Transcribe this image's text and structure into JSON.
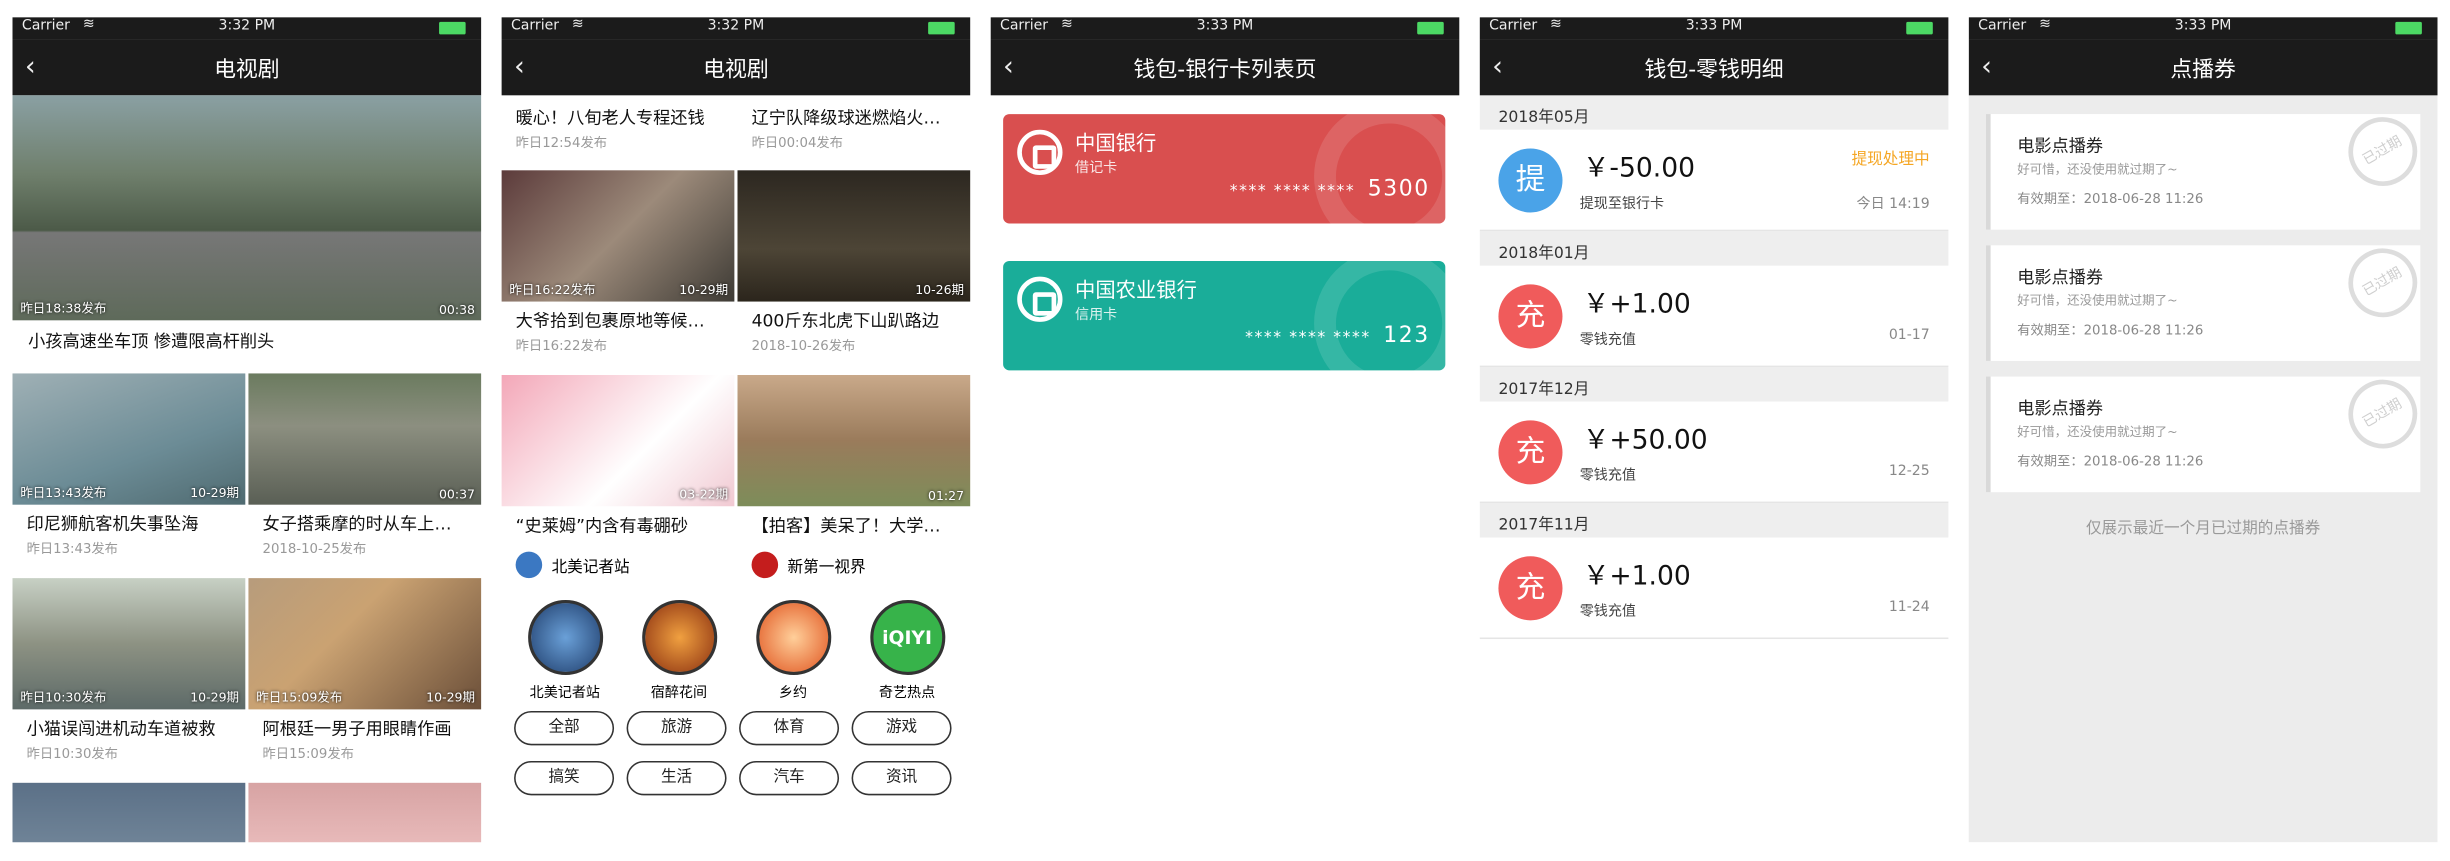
{
  "status": {
    "carrier": "Carrier",
    "screens": [
      {
        "time": "3:32 PM"
      },
      {
        "time": "3:32 PM"
      },
      {
        "time": "3:33 PM"
      },
      {
        "time": "3:33 PM"
      },
      {
        "time": "3:33 PM"
      }
    ]
  },
  "screen1": {
    "title": "电视剧",
    "hero": {
      "left": "昨日18:38发布",
      "right": "00:38",
      "caption": "小孩高速坐车顶 惨遭限高杆削头"
    },
    "rows": [
      [
        {
          "left": "昨日13:43发布",
          "right": "10-29期",
          "title": "印尼狮航客机失事坠海",
          "sub": "昨日13:43发布"
        },
        {
          "left": "",
          "right": "00:37",
          "title": "女子搭乘摩的时从车上…",
          "sub": "2018-10-25发布"
        }
      ],
      [
        {
          "left": "昨日10:30发布",
          "right": "10-29期",
          "title": "小猫误闯进机动车道被救",
          "sub": "昨日10:30发布"
        },
        {
          "left": "昨日15:09发布",
          "right": "10-29期",
          "title": "阿根廷一男子用眼睛作画",
          "sub": "昨日15:09发布"
        }
      ]
    ]
  },
  "screen2": {
    "title": "电视剧",
    "top": [
      {
        "title": "暖心！八旬老人专程还钱",
        "sub": "昨日12:54发布"
      },
      {
        "title": "辽宁队降级球迷燃焰火…",
        "sub": "昨日00:04发布"
      }
    ],
    "row1": [
      {
        "left": "昨日16:22发布",
        "right": "10-29期",
        "title": "大爷拾到包裹原地等候…",
        "sub": "昨日16:22发布"
      },
      {
        "left": "",
        "right": "10-26期",
        "title": "400斤东北虎下山趴路边",
        "sub": "2018-10-26发布"
      }
    ],
    "row2": [
      {
        "left": "",
        "right": "03-22期",
        "title": "“史莱姆”内含有毒硼砂",
        "channel": "北美记者站"
      },
      {
        "left": "",
        "right": "01:27",
        "title": "【拍客】美呆了！大学…",
        "channel": "新第一视界"
      }
    ],
    "avatars": [
      "北美记者站",
      "宿醉花间",
      "乡约",
      "奇艺热点"
    ],
    "chips": [
      "全部",
      "旅游",
      "体育",
      "游戏",
      "搞笑",
      "生活",
      "汽车",
      "资讯"
    ]
  },
  "screen3": {
    "title": "钱包-银行卡列表页",
    "cards": [
      {
        "name": "中国银行",
        "type": "借记卡",
        "mask": "**** **** ****",
        "last": "5300",
        "color": "#d94f4f"
      },
      {
        "name": "中国农业银行",
        "type": "信用卡",
        "mask": "**** **** ****",
        "last": "123",
        "color": "#1aad99"
      }
    ]
  },
  "screen4": {
    "title": "钱包-零钱明细",
    "sections": [
      {
        "month": "2018年05月",
        "icon": "提",
        "amount": "￥-50.00",
        "desc": "提现至银行卡",
        "status": "提现处理中",
        "date": "今日 14:19",
        "color": "#4aa3e8"
      },
      {
        "month": "2018年01月",
        "icon": "充",
        "amount": "￥+1.00",
        "desc": "零钱充值",
        "status": "",
        "date": "01-17",
        "color": "#f05b5b"
      },
      {
        "month": "2017年12月",
        "icon": "充",
        "amount": "￥+50.00",
        "desc": "零钱充值",
        "status": "",
        "date": "12-25",
        "color": "#f05b5b"
      },
      {
        "month": "2017年11月",
        "icon": "充",
        "amount": "￥+1.00",
        "desc": "零钱充值",
        "status": "",
        "date": "11-24",
        "color": "#f05b5b"
      }
    ]
  },
  "screen5": {
    "title": "点播券",
    "coupons": [
      {
        "title": "电影点播券",
        "sub": "好可惜，还没使用就过期了~",
        "valid": "有效期至：2018-06-28 11:26",
        "stamp": "已过期"
      },
      {
        "title": "电影点播券",
        "sub": "好可惜，还没使用就过期了~",
        "valid": "有效期至：2018-06-28 11:26",
        "stamp": "已过期"
      },
      {
        "title": "电影点播券",
        "sub": "好可惜，还没使用就过期了~",
        "valid": "有效期至：2018-06-28 11:26",
        "stamp": "已过期"
      }
    ],
    "footer": "仅展示最近一个月已过期的点播券"
  }
}
